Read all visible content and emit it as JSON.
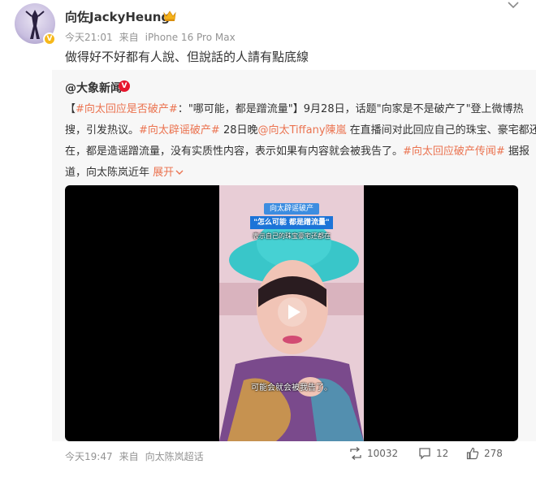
{
  "post": {
    "username": "向佐JackyHeung",
    "time": "今天21:01",
    "source_prefix": "来自",
    "source": "iPhone 16 Pro Max",
    "text": "做得好不好都有人說、但說話的人請有點底線"
  },
  "repost": {
    "user": "@大象新闻",
    "lines": [
      [
        {
          "t": "【",
          "tag": false
        },
        {
          "t": "#向太回应是否破产#",
          "tag": true
        },
        {
          "t": "：\"哪可能，都是蹭流量\"】9月28日，话题\"向家是不是破产了\"登上微博热",
          "tag": false
        }
      ],
      [
        {
          "t": "搜，引发热议。",
          "tag": false
        },
        {
          "t": "#向太辟谣破产#",
          "tag": true
        },
        {
          "t": " 28日晚",
          "tag": false
        },
        {
          "t": "@向太Tiffany陳嵐",
          "tag": true
        },
        {
          "t": " 在直播间对此回应自己的珠宝、豪宅都还",
          "tag": false
        }
      ],
      [
        {
          "t": "在，都是造谣蹭流量，没有实质性内容，表示如果有内容就会被我告了。",
          "tag": false
        },
        {
          "t": "#向太回应破产传闻#",
          "tag": true
        },
        {
          "t": " 据报",
          "tag": false
        }
      ],
      [
        {
          "t": "道，向太陈岚近年 ",
          "tag": false
        }
      ]
    ],
    "expand_label": "展开",
    "video": {
      "caption_tag": "向太辟谣破产",
      "caption_title": "\"怎么可能 都是蹭流量\"",
      "caption_sub": "表示自己的珠宝豪宅还都在",
      "subtitle": "可能会就会被我告了。"
    }
  },
  "footer": {
    "time": "今天19:47",
    "source_prefix": "来自",
    "source": "向太陈岚超话",
    "reposts": "10032",
    "comments": "12",
    "likes": "278"
  },
  "colors": {
    "accent_link": "#eb7350",
    "meta_gray": "#939393",
    "verified_gold": "#f6b81a",
    "verified_red": "#e6162d"
  },
  "icons": [
    "verified-badge-icon",
    "crown-icon",
    "chevron-down-icon",
    "play-icon",
    "repost-icon",
    "comment-icon",
    "like-icon"
  ]
}
